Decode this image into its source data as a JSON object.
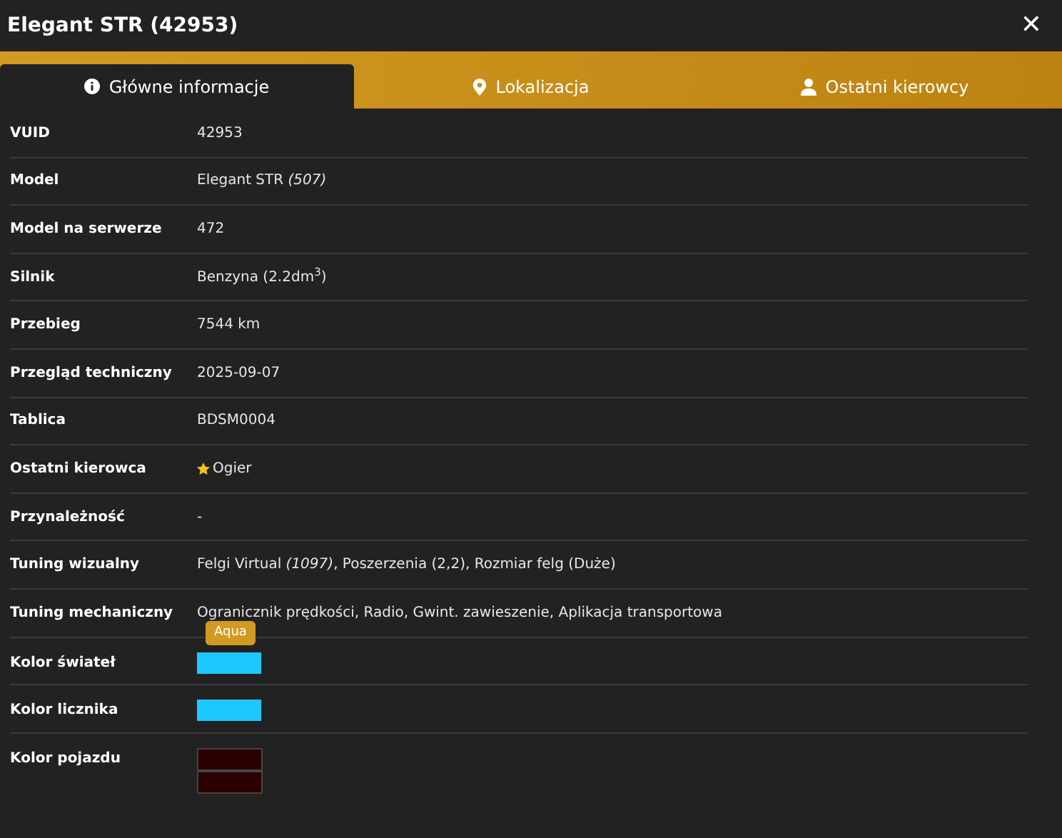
{
  "window": {
    "title": "Elegant STR (42953)",
    "close": "✕"
  },
  "tabs": [
    {
      "label": "Główne informacje",
      "kind": "info",
      "selected": true
    },
    {
      "label": "Lokalizacja",
      "kind": "pin",
      "selected": false
    },
    {
      "label": "Ostatni kierowcy",
      "kind": "user",
      "selected": false
    }
  ],
  "rows": [
    {
      "kind": "text",
      "label": "VUID",
      "value": "42953"
    },
    {
      "kind": "text",
      "label": "Model",
      "value": "Elegant STR *(507)*"
    },
    {
      "kind": "text",
      "label": "Model na serwerze",
      "value": "472"
    },
    {
      "kind": "text",
      "label": "Silnik",
      "value": "Benzyna (2.2dm$^{3}$)"
    },
    {
      "kind": "text",
      "label": "Przebieg",
      "value": "7544 km"
    },
    {
      "kind": "text",
      "label": "Przegląd techniczny",
      "value": "2025-09-07"
    },
    {
      "kind": "text",
      "label": "Tablica",
      "value": "BDSM0004"
    },
    {
      "kind": "driver",
      "label": "Ostatni kierowca",
      "value": "Ogier"
    },
    {
      "kind": "text",
      "label": "Przynależność",
      "value": "-"
    },
    {
      "kind": "text",
      "label": "Tuning wizualny",
      "value": "Felgi Virtual *(1097)*, Poszerzenia (2,2), Rozmiar felg (Duże)"
    },
    {
      "kind": "text",
      "label": "Tuning mechaniczny",
      "value": "Ogranicznik prędkości, Radio, Gwint. zawieszenie, Aplikacja transportowa"
    },
    {
      "kind": "color",
      "label": "Kolor świateł",
      "swatches": [
        {
          "color": "#1ec8ff"
        }
      ],
      "tooltip": "Aqua"
    },
    {
      "kind": "color",
      "label": "Kolor licznika",
      "swatches": [
        {
          "color": "#1ec8ff"
        }
      ]
    },
    {
      "kind": "color",
      "label": "Kolor pojazdu",
      "swatches": [
        {
          "color": "#2a0000"
        },
        {
          "color": "#2a0000"
        }
      ]
    }
  ]
}
